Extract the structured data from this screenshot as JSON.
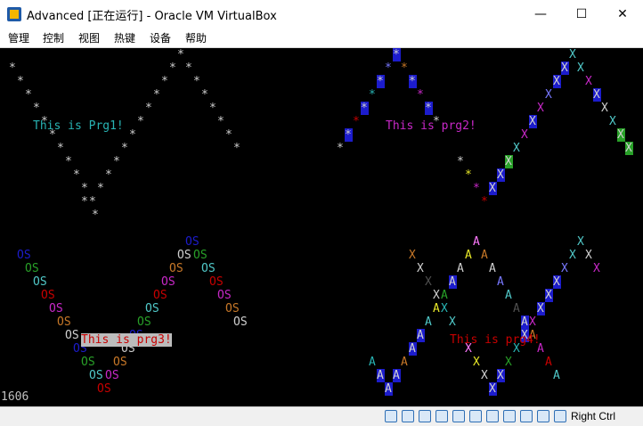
{
  "window": {
    "title": "Advanced [正在运行] - Oracle VM VirtualBox",
    "minimize_glyph": "—",
    "maximize_glyph": "☐",
    "close_glyph": "✕"
  },
  "menu": {
    "items": [
      {
        "label": "管理"
      },
      {
        "label": "控制"
      },
      {
        "label": "视图"
      },
      {
        "label": "热键"
      },
      {
        "label": "设备"
      },
      {
        "label": "帮助"
      }
    ]
  },
  "vm_screen": {
    "prg1_label": "This is Prg1!",
    "prg2_label": "This is prg2!",
    "prg3_label": "This is prg3!",
    "prg4_label": "This is prg4!",
    "counter": "1606",
    "colors": {
      "prg1_text": "#28b4b4",
      "prg2_text": "#c828c8",
      "prg3_text": "#c80000",
      "prg3_bg": "#bcbcbc",
      "prg4_text": "#c80000",
      "block": "#1c1ccc",
      "background": "#000000"
    }
  },
  "statusbar": {
    "host_key": "Right Ctrl",
    "icons": [
      "hard-disk-icon",
      "optical-drive-icon",
      "audio-icon",
      "network-icon",
      "usb-icon",
      "shared-folder-icon",
      "display-icon",
      "video-capture-icon",
      "cpu-icon",
      "mouse-integration-icon",
      "arrow-down-icon"
    ]
  }
}
